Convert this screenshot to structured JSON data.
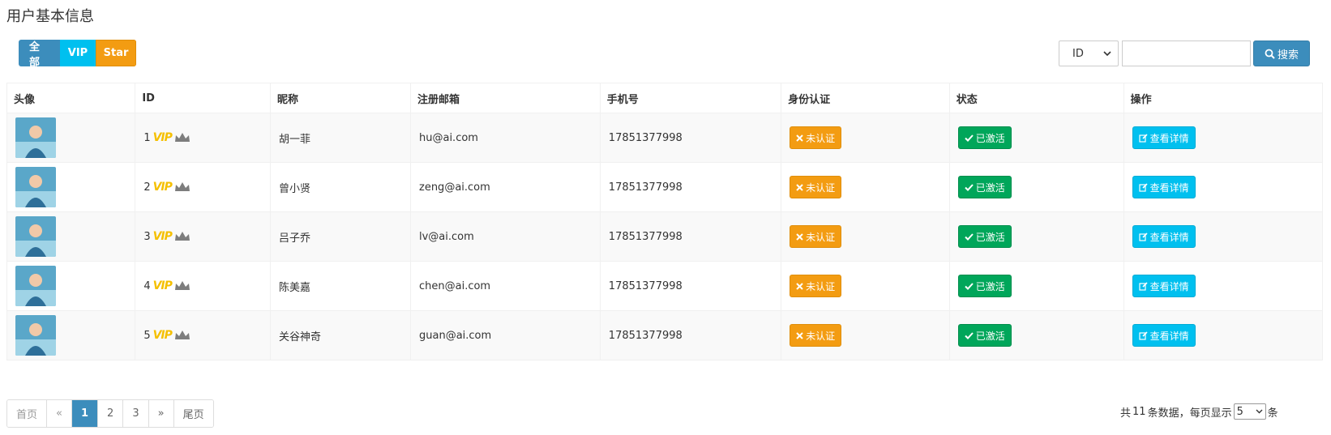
{
  "page": {
    "title": "用户基本信息"
  },
  "filters": {
    "all": "全部",
    "vip": "VIP",
    "star": "Star"
  },
  "search": {
    "field_value": "ID",
    "button": "搜索",
    "input_value": ""
  },
  "table": {
    "headers": [
      "头像",
      "ID",
      "昵称",
      "注册邮箱",
      "手机号",
      "身份认证",
      "状态",
      "操作"
    ],
    "rows": [
      {
        "id": "1",
        "vip": "VIP",
        "name": "胡一菲",
        "email": "hu@ai.com",
        "phone": "17851377998",
        "auth": "未认证",
        "status": "已激活",
        "action": "查看详情"
      },
      {
        "id": "2",
        "vip": "VIP",
        "name": "曾小贤",
        "email": "zeng@ai.com",
        "phone": "17851377998",
        "auth": "未认证",
        "status": "已激活",
        "action": "查看详情"
      },
      {
        "id": "3",
        "vip": "VIP",
        "name": "吕子乔",
        "email": "lv@ai.com",
        "phone": "17851377998",
        "auth": "未认证",
        "status": "已激活",
        "action": "查看详情"
      },
      {
        "id": "4",
        "vip": "VIP",
        "name": "陈美嘉",
        "email": "chen@ai.com",
        "phone": "17851377998",
        "auth": "未认证",
        "status": "已激活",
        "action": "查看详情"
      },
      {
        "id": "5",
        "vip": "VIP",
        "name": "关谷神奇",
        "email": "guan@ai.com",
        "phone": "17851377998",
        "auth": "未认证",
        "status": "已激活",
        "action": "查看详情"
      }
    ]
  },
  "pagination": {
    "first": "首页",
    "prev": "«",
    "pages": [
      "1",
      "2",
      "3"
    ],
    "active": "1",
    "next": "»",
    "last": "尾页"
  },
  "summary": {
    "prefix": "共",
    "total": "11",
    "middle": "条数据，每页显示",
    "page_size": "5",
    "suffix": "条"
  },
  "colors": {
    "primary": "#3c8dbc",
    "info": "#00c0ef",
    "warning": "#f39c12",
    "success": "#00a65a"
  },
  "icons": [
    "search-icon",
    "times-icon",
    "check-icon",
    "edit-icon",
    "crown-icon",
    "chevron-down-icon"
  ]
}
